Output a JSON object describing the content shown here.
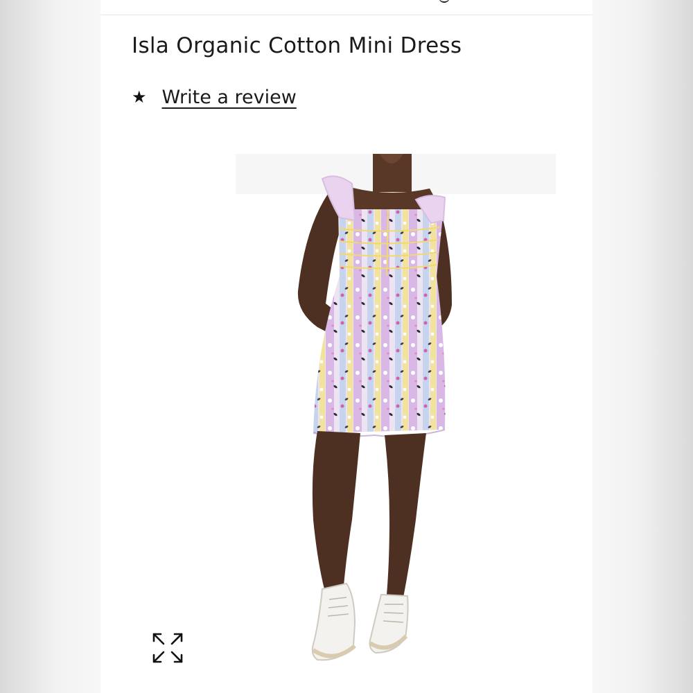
{
  "product": {
    "title": "Isla Organic Cotton Mini Dress",
    "rating_icon": "star-icon",
    "review_link_label": "Write a review"
  },
  "gallery": {
    "image_subject": "model wearing floral mini dress with white high-top sneakers",
    "expand_icon": "expand-arrows-icon"
  },
  "colors": {
    "text": "#1a1a1a",
    "background": "#ffffff",
    "dress_lilac": "#d9b8e6",
    "dress_yellow": "#f2e29a",
    "dress_blue": "#c6d4ee"
  }
}
